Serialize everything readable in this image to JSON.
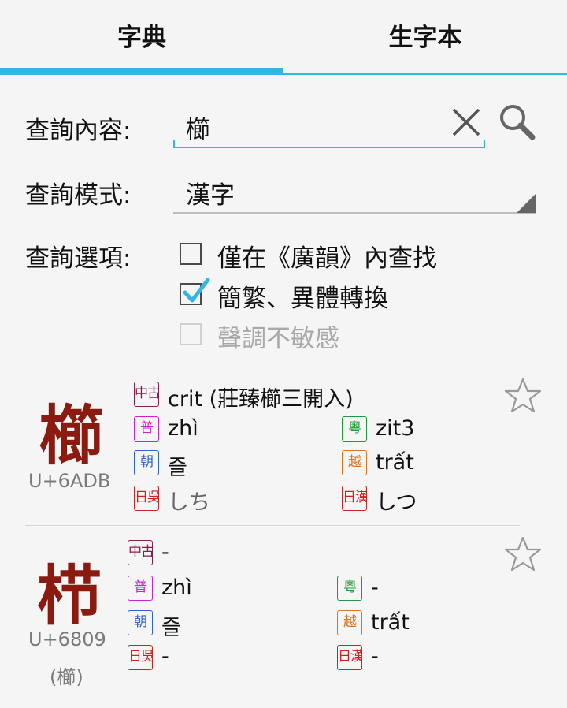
{
  "tabs": [
    {
      "label": "字典",
      "selected": true
    },
    {
      "label": "生字本",
      "selected": false
    }
  ],
  "search": {
    "query_label": "查詢內容:",
    "query_value": "櫛",
    "mode_label": "查詢模式:",
    "mode_value": "漢字",
    "options_label": "查詢選項:",
    "options": [
      {
        "label": "僅在《廣韻》內查找",
        "checked": false,
        "enabled": true
      },
      {
        "label": "簡繁、異體轉換",
        "checked": true,
        "enabled": true
      },
      {
        "label": "聲調不敏感",
        "checked": false,
        "enabled": false
      }
    ]
  },
  "badges": {
    "mc": "中古",
    "pu": "普",
    "ct": "粵",
    "kr": "朝",
    "vn": "越",
    "jp_go": "日吳",
    "jp_kan": "日漢"
  },
  "colors": {
    "mc": "#8a1e4a",
    "pu": "#d21ed2",
    "ct": "#1f9a3a",
    "kr": "#2a64d8",
    "vn": "#e0701a",
    "jp": "#d22020",
    "char": "#8b1a10",
    "accent": "#33b5e5"
  },
  "entries": [
    {
      "char": "櫛",
      "code": "U+6ADB",
      "variant": "",
      "mc": "crit (莊臻櫛三開入)",
      "pu": "zhì",
      "ct": "zit3",
      "kr": "즐",
      "vn": "trất",
      "jp_go": "しち",
      "jp_kan": "しつ"
    },
    {
      "char": "栉",
      "code": "U+6809",
      "variant": "(櫛)",
      "mc": "-",
      "pu": "zhì",
      "ct": "-",
      "kr": "즐",
      "vn": "trất",
      "jp_go": "-",
      "jp_kan": "-"
    }
  ]
}
